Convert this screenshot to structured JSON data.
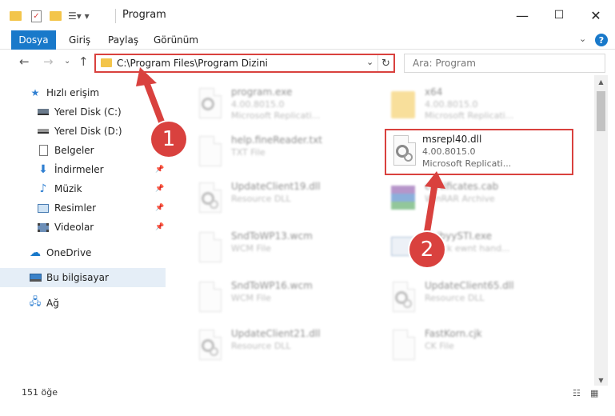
{
  "window": {
    "title": "Program",
    "minimize": "—",
    "maximize": "☐",
    "close": "✕"
  },
  "ribbon": {
    "file_tab": "Dosya",
    "tabs": [
      "Giriş",
      "Paylaş",
      "Görünüm"
    ]
  },
  "nav": {
    "address": "C:\\Program Files\\Program Dizini",
    "search_placeholder": "Ara: Program"
  },
  "sidebar": {
    "items": [
      {
        "label": "Hızlı erişim",
        "icon": "star-icon"
      },
      {
        "label": "Yerel Disk (C:)",
        "icon": "drive-icon"
      },
      {
        "label": "Yerel Disk (D:)",
        "icon": "drive-icon"
      },
      {
        "label": "Belgeler",
        "icon": "documents-icon"
      },
      {
        "label": "İndirmeler",
        "icon": "download-icon"
      },
      {
        "label": "Müzik",
        "icon": "music-icon"
      },
      {
        "label": "Resimler",
        "icon": "pictures-icon"
      },
      {
        "label": "Videolar",
        "icon": "videos-icon"
      },
      {
        "label": "OneDrive",
        "icon": "cloud-icon"
      },
      {
        "label": "Bu bilgisayar",
        "icon": "computer-icon"
      },
      {
        "label": "Ağ",
        "icon": "network-icon"
      }
    ]
  },
  "files": [
    {
      "name": "program.exe",
      "meta1": "4.00.8015.0",
      "meta2": "Microsoft Replicati..."
    },
    {
      "name": "x64",
      "meta1": "4.00.8015.0",
      "meta2": "Microsoft Replicati..."
    },
    {
      "name": "help.fineReader.txt",
      "meta1": "TXT File",
      "meta2": ""
    },
    {
      "name": "UpdateClient19.dll",
      "meta1": "Resource DLL",
      "meta2": ""
    },
    {
      "name": "certificates.cab",
      "meta1": "WinRAR Archive",
      "meta2": ""
    },
    {
      "name": "SndToWP13.wcm",
      "meta1": "WCM File",
      "meta2": ""
    },
    {
      "name": "ShibyySTI.exe",
      "meta1": "DIY ck ewnt hand...",
      "meta2": ""
    },
    {
      "name": "SndToWP16.wcm",
      "meta1": "WCM File",
      "meta2": ""
    },
    {
      "name": "UpdateClient65.dll",
      "meta1": "Resource DLL",
      "meta2": ""
    },
    {
      "name": "UpdateClient21.dll",
      "meta1": "Resource DLL",
      "meta2": ""
    },
    {
      "name": "FastKorn.cjk",
      "meta1": "CK File",
      "meta2": ""
    }
  ],
  "selected_file": {
    "name": "msrepl40.dll",
    "version": "4.00.8015.0",
    "company": "Microsoft Replicati..."
  },
  "status": {
    "count": "151 öğe"
  },
  "annotations": {
    "step1": "1",
    "step2": "2",
    "color": "#d9413e"
  }
}
